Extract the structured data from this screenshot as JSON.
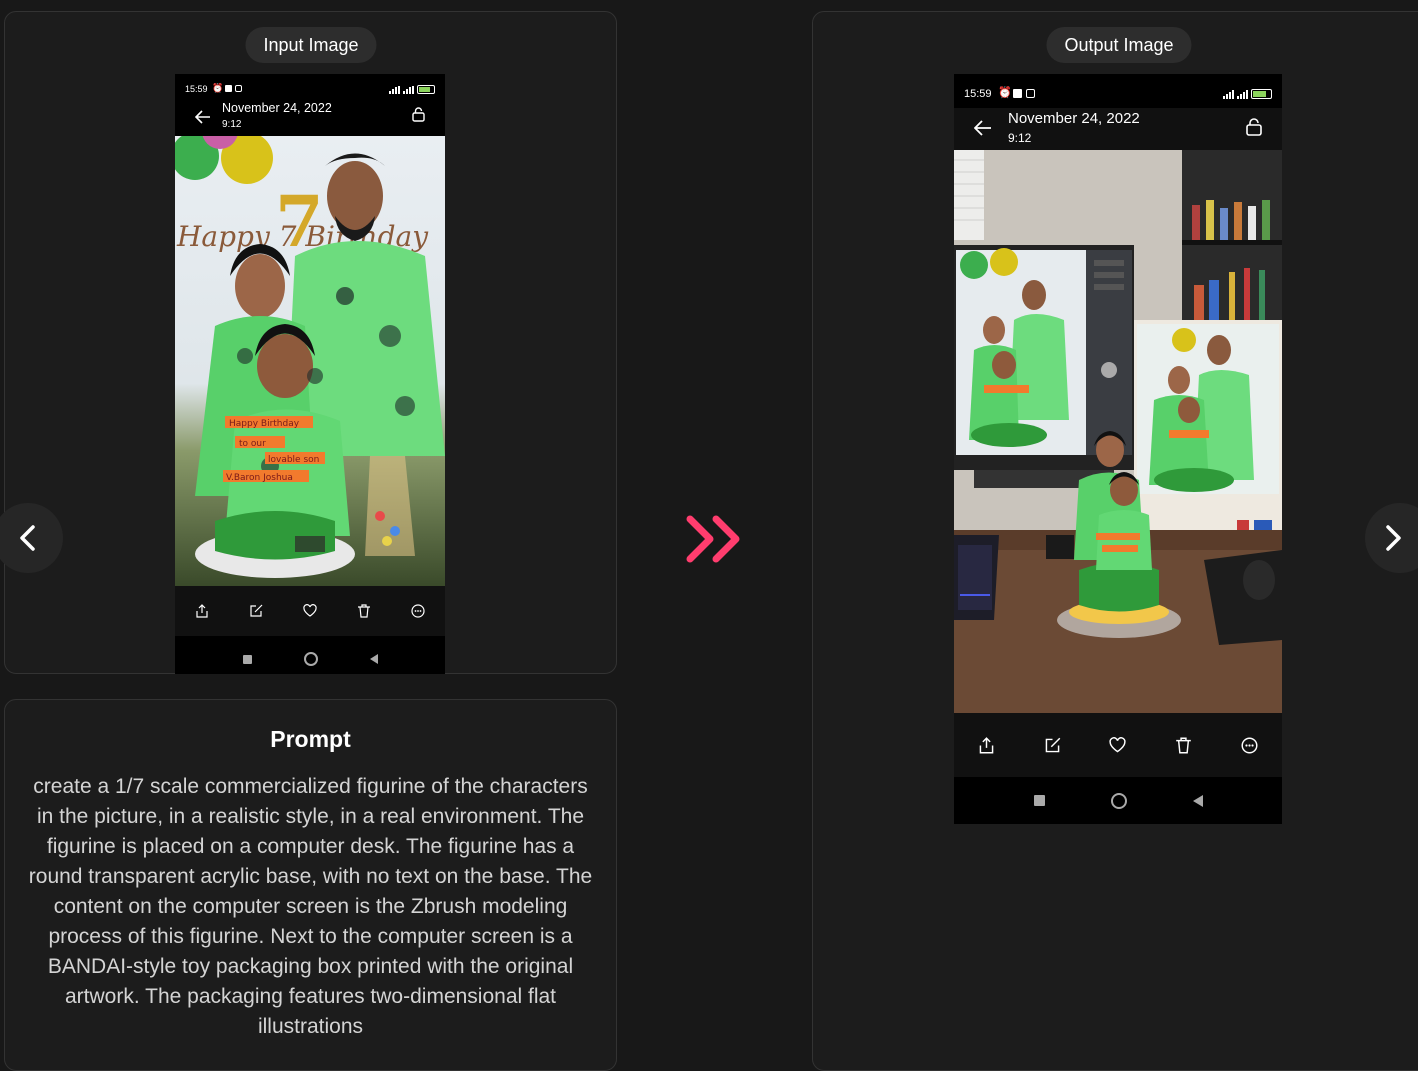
{
  "input_panel": {
    "label": "Input Image",
    "phone": {
      "status_time": "15:59",
      "date": "November 24, 2022",
      "time": "9:12",
      "cake_lines": [
        "Happy Birthday",
        "to our",
        "lovable son",
        "V.Baron Joshua"
      ],
      "banner_text": "Happy 7 Birthday"
    }
  },
  "output_panel": {
    "label": "Output Image",
    "phone": {
      "status_time": "15:59",
      "date": "November 24, 2022",
      "time": "9:12"
    }
  },
  "prompt": {
    "title": "Prompt",
    "text": "create a 1/7 scale commercialized figurine of the characters in the picture, in a realistic style, in a real environment. The figurine is placed on a computer desk. The figurine has a round transparent acrylic base, with no text on the base. The content on the computer screen is the Zbrush modeling process of this figurine. Next to the computer screen is a BANDAI-style toy packaging box printed with the original artwork. The packaging features two-dimensional flat illustrations"
  },
  "icons": {
    "prev": "chevron-left-icon",
    "next": "chevron-right-icon",
    "arrow": "double-chevron-right-icon",
    "toolbar": [
      "share-icon",
      "edit-icon",
      "heart-icon",
      "trash-icon",
      "more-icon"
    ],
    "nav": [
      "square-icon",
      "circle-icon",
      "triangle-back-icon"
    ]
  },
  "colors": {
    "accent": "#ff3d6e",
    "background": "#181818",
    "panel": "#1c1c1c",
    "pill": "#2d2d2d"
  }
}
